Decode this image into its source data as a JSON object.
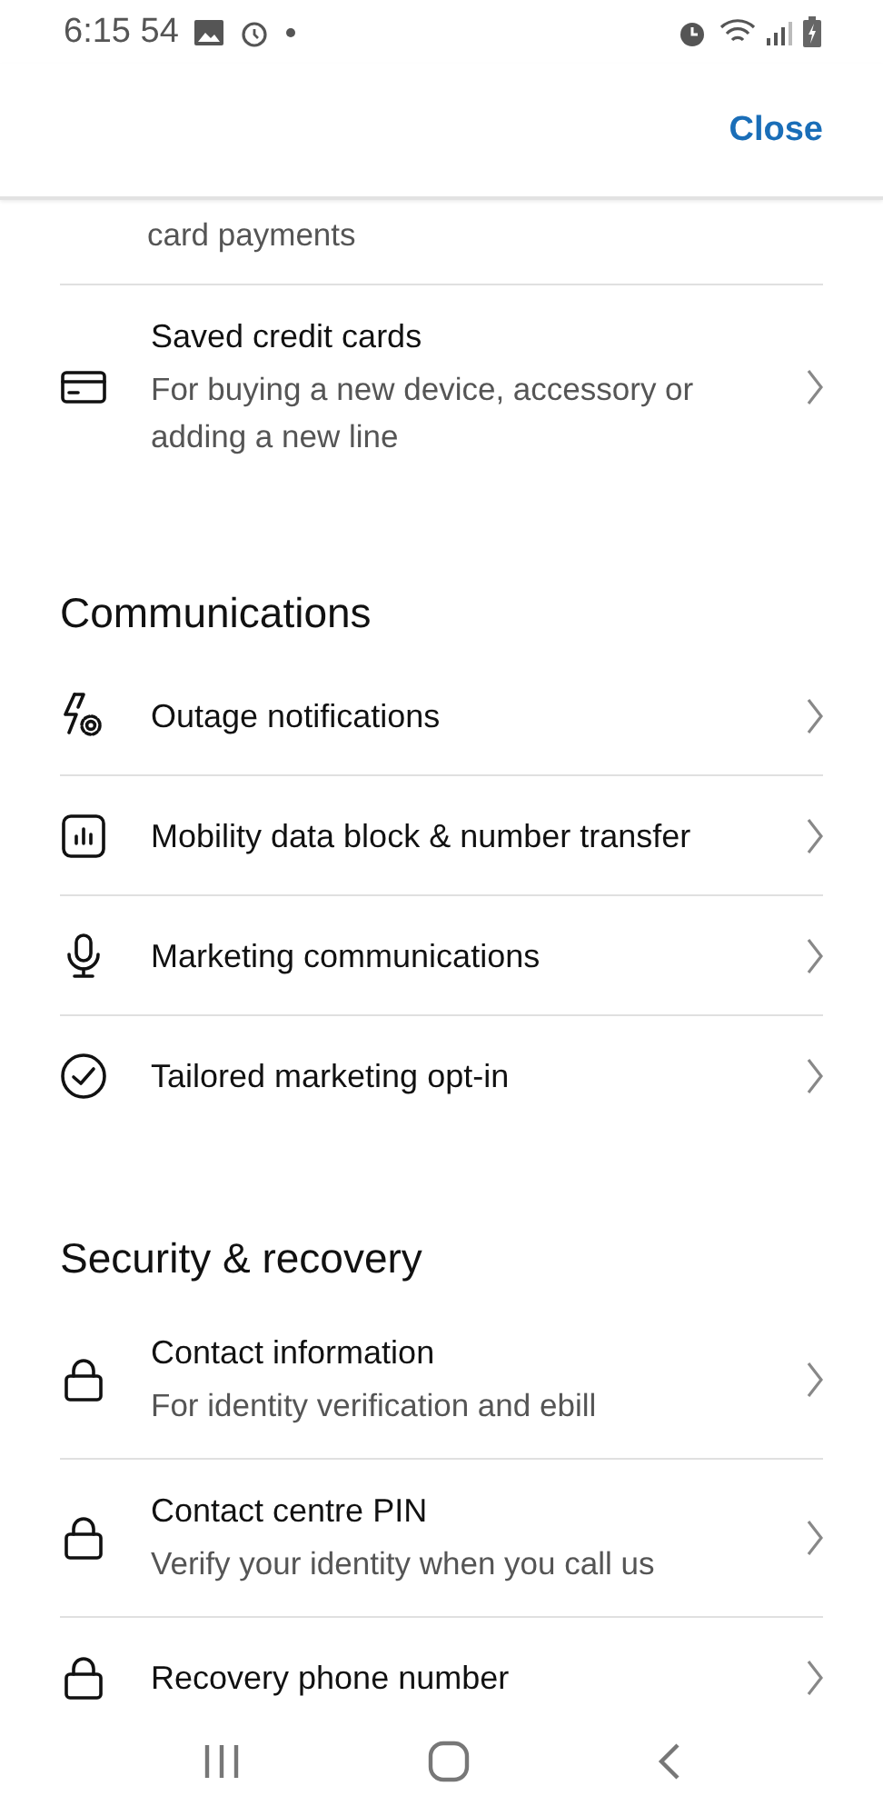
{
  "status_bar": {
    "time": "6:15 54"
  },
  "header": {
    "close": "Close"
  },
  "sections": [
    {
      "items": [
        {
          "kind": "clipped",
          "subtitle": "card payments"
        },
        {
          "kind": "row",
          "title": "Saved credit cards",
          "subtitle": "For buying a new device, accessory or adding a new line"
        }
      ]
    },
    {
      "heading": "Communications",
      "items": [
        {
          "kind": "row",
          "title": "Outage notifications"
        },
        {
          "kind": "row",
          "title": "Mobility data block & number transfer"
        },
        {
          "kind": "row",
          "title": "Marketing communications"
        },
        {
          "kind": "row",
          "title": "Tailored marketing opt-in"
        }
      ]
    },
    {
      "heading": "Security & recovery",
      "items": [
        {
          "kind": "row",
          "title": "Contact information",
          "subtitle": "For identity verification and ebill"
        },
        {
          "kind": "row",
          "title": "Contact centre PIN",
          "subtitle": "Verify your identity when you call us"
        },
        {
          "kind": "row",
          "title": "Recovery phone number"
        }
      ]
    }
  ]
}
